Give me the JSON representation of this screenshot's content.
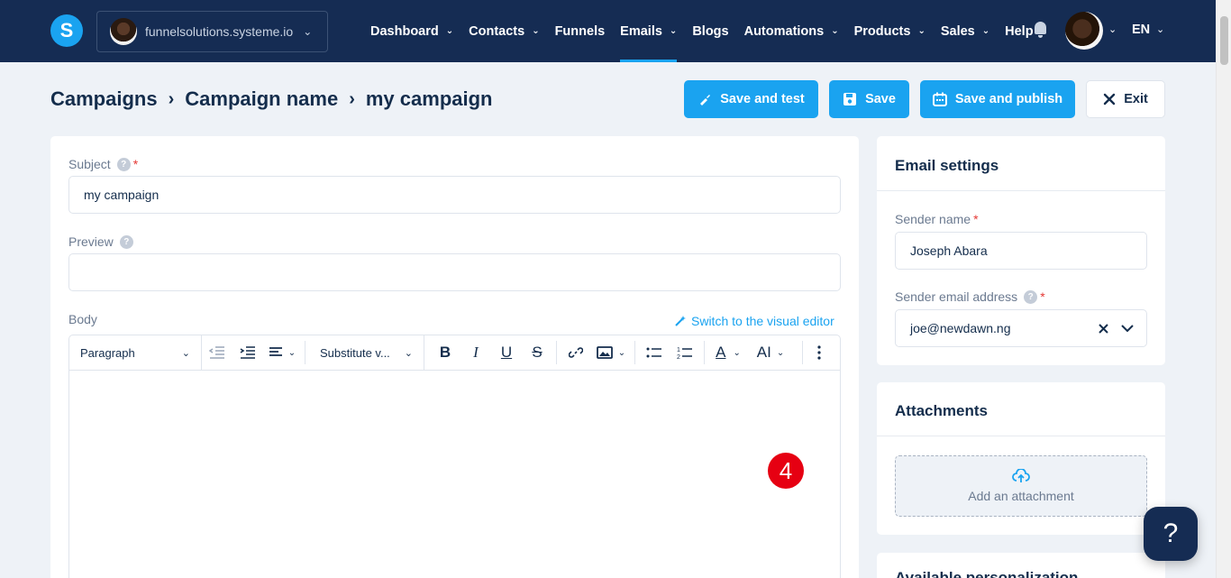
{
  "nav": {
    "workspace": "funnelsolutions.systeme.io",
    "items": [
      {
        "label": "Dashboard",
        "dropdown": true
      },
      {
        "label": "Contacts",
        "dropdown": true
      },
      {
        "label": "Funnels",
        "dropdown": false
      },
      {
        "label": "Emails",
        "dropdown": true,
        "active": true
      },
      {
        "label": "Blogs",
        "dropdown": false
      },
      {
        "label": "Automations",
        "dropdown": true
      },
      {
        "label": "Products",
        "dropdown": true
      },
      {
        "label": "Sales",
        "dropdown": true
      },
      {
        "label": "Help",
        "dropdown": false
      }
    ],
    "lang": "EN",
    "logo_letter": "S"
  },
  "breadcrumb": [
    "Campaigns",
    "Campaign name",
    "my campaign"
  ],
  "actions": {
    "save_test": "Save and test",
    "save": "Save",
    "save_publish": "Save and publish",
    "exit": "Exit"
  },
  "form": {
    "subject_label": "Subject",
    "subject_value": "my campaign",
    "preview_label": "Preview",
    "preview_value": "",
    "body_label": "Body",
    "switch_editor": "Switch to the visual editor"
  },
  "toolbar": {
    "paragraph": "Paragraph",
    "substitute": "Substitute v...",
    "bold": "B",
    "italic": "I",
    "underline": "U",
    "strike": "S",
    "text_color": "A",
    "font_size": "AI"
  },
  "badge": "4",
  "email_settings": {
    "title": "Email settings",
    "sender_name_label": "Sender name",
    "sender_name": "Joseph Abara",
    "sender_email_label": "Sender email address",
    "sender_email": "joe@newdawn.ng"
  },
  "attachments": {
    "title": "Attachments",
    "add": "Add an attachment"
  },
  "available_title": "Available personalization",
  "help_bubble": "?",
  "colors": {
    "primary": "#1aa3f0",
    "nav_bg": "#152c53",
    "text": "#142d4c",
    "required": "#e53935",
    "badge": "#e60012"
  }
}
